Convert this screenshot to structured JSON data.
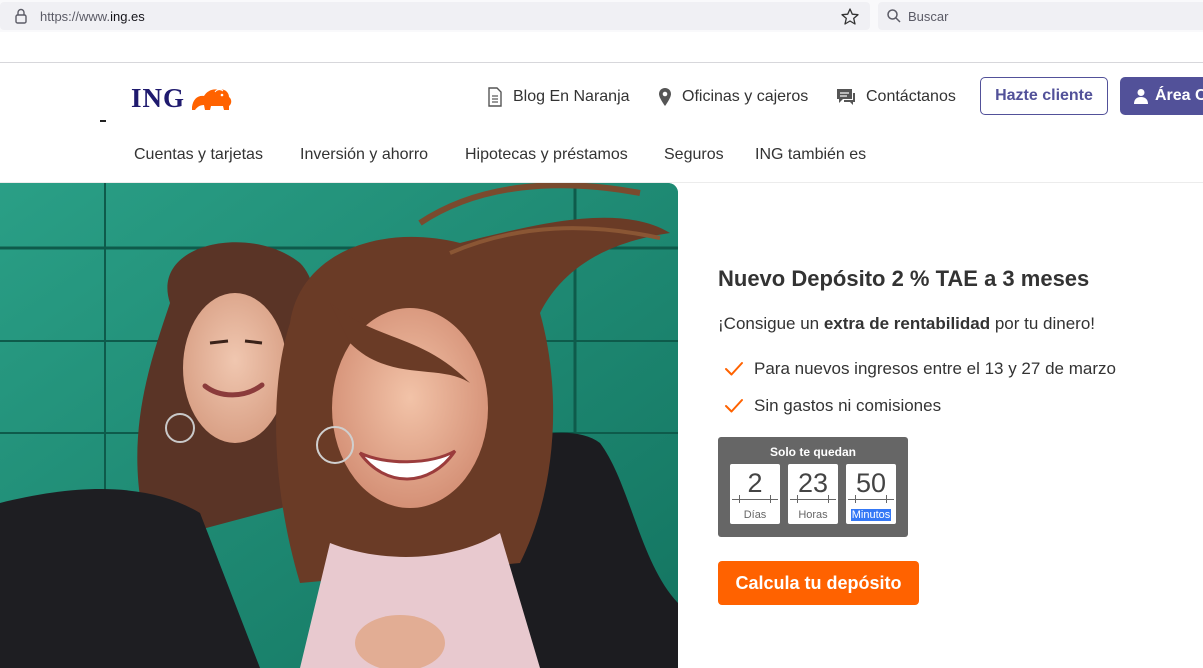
{
  "browser": {
    "url_prefix": "https://www.",
    "url_domain": "ing.es",
    "search_placeholder": "Buscar"
  },
  "header": {
    "logo_text": "ING",
    "logo_icon": "lion-icon",
    "utility_links": [
      {
        "label": "Blog En Naranja",
        "icon": "document-icon"
      },
      {
        "label": "Oficinas y cajeros",
        "icon": "location-pin-icon"
      },
      {
        "label": "Contáctanos",
        "icon": "chat-icon"
      }
    ],
    "hazte_cliente": "Hazte cliente",
    "area_clientes": "Área C",
    "brand_color": "#525199"
  },
  "nav": {
    "items": [
      "Cuentas y tarjetas",
      "Inversión y ahorro",
      "Hipotecas y préstamos",
      "Seguros",
      "ING también es"
    ]
  },
  "promo": {
    "title": "Nuevo Depósito 2 % TAE a 3 meses",
    "sub_pre": "¡Consigue un ",
    "sub_bold": "extra de rentabilidad",
    "sub_post": " por tu dinero!",
    "bullets": [
      "Para nuevos ingresos entre el 13 y 27 de marzo",
      "Sin gastos ni comisiones"
    ],
    "accent_color": "#ff6200"
  },
  "countdown": {
    "title": "Solo te quedan",
    "days": "2",
    "days_label": "Días",
    "hours": "23",
    "hours_label": "Horas",
    "minutes": "50",
    "minutes_label": "Minutos"
  },
  "cta": {
    "label": "Calcula tu depósito"
  }
}
